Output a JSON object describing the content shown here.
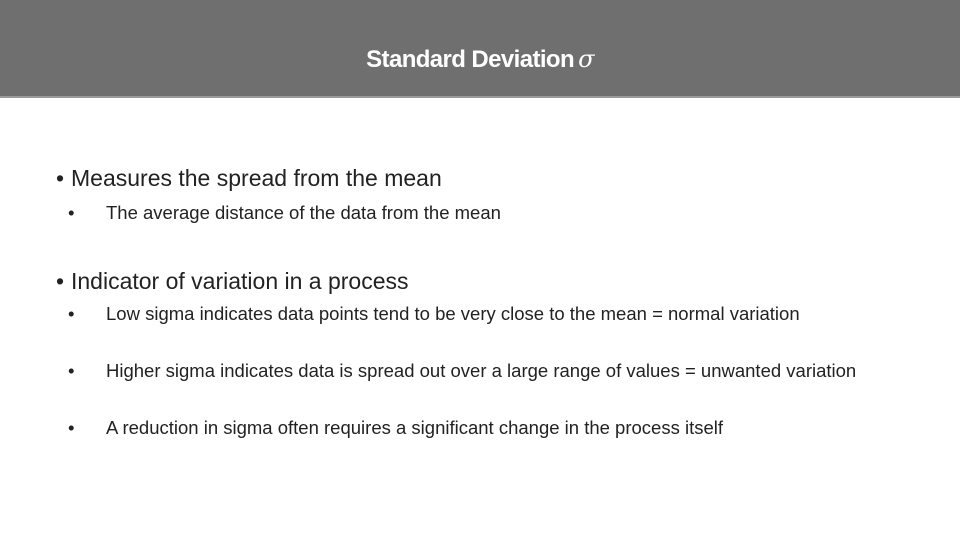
{
  "slide": {
    "title": "Standard Deviation",
    "title_symbol": "σ",
    "bullet_glyph": "•",
    "points": [
      {
        "text": "Measures the spread from the mean",
        "subpoints": [
          "The average distance of the data from the mean"
        ]
      },
      {
        "text": "Indicator of variation in a process",
        "subpoints": [
          "Low sigma indicates data points tend to be very close to the mean = normal variation",
          "Higher sigma indicates data is spread out over a large range of values = unwanted variation",
          "A reduction in sigma often requires a significant change in the process itself"
        ]
      }
    ]
  },
  "colors": {
    "header_bg": "#6f6f6f",
    "header_text": "#ffffff",
    "body_text": "#222222"
  }
}
